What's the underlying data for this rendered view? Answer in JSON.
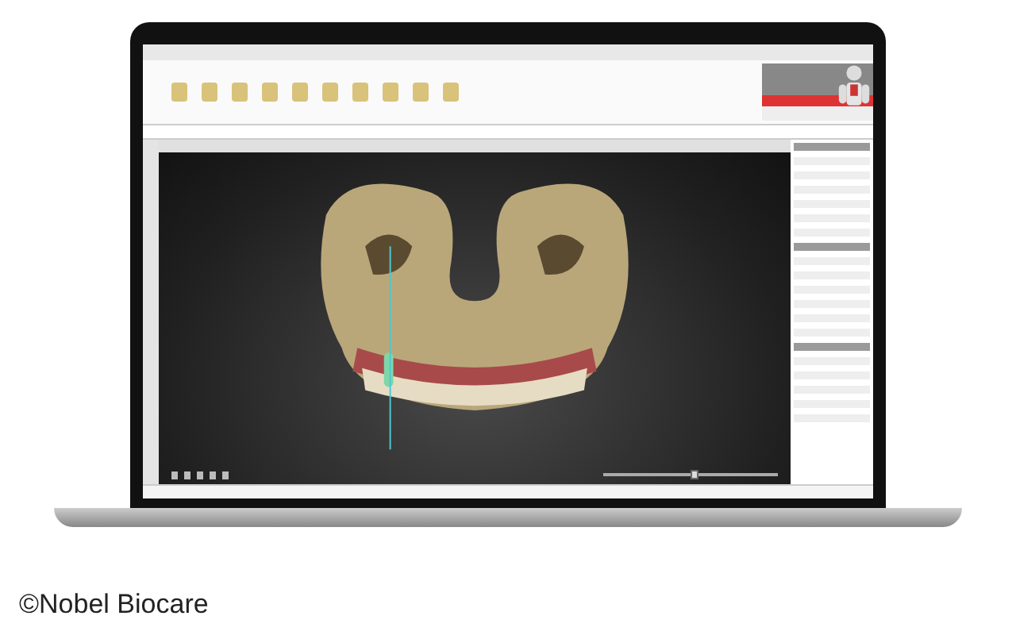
{
  "viewport": {
    "zoom_slider": {
      "level": 0.52
    }
  },
  "caption": "©Nobel Biocare"
}
